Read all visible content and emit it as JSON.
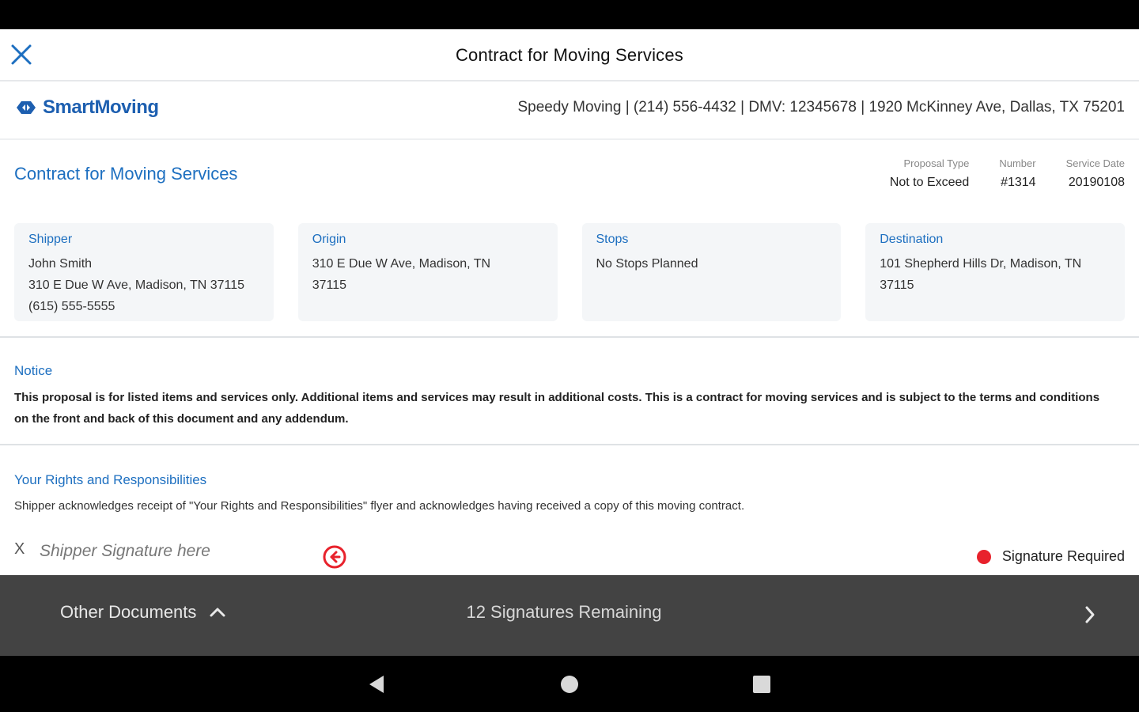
{
  "topbar": {
    "title": "Contract for Moving Services"
  },
  "company": {
    "logo_text": "SmartMoving",
    "info": "Speedy Moving | (214) 556-4432 | DMV: 12345678 | 1920 McKinney Ave, Dallas, TX 75201"
  },
  "document": {
    "title": "Contract for Moving Services",
    "meta": [
      {
        "label": "Proposal Type",
        "value": "Not to Exceed"
      },
      {
        "label": "Number",
        "value": "#1314"
      },
      {
        "label": "Service Date",
        "value": "20190108"
      }
    ]
  },
  "cards": [
    {
      "title": "Shipper",
      "lines": [
        "John Smith",
        "310 E Due W Ave, Madison, TN 37115",
        "(615) 555-5555"
      ]
    },
    {
      "title": "Origin",
      "lines": [
        "310 E Due W Ave, Madison, TN",
        "37115"
      ]
    },
    {
      "title": "Stops",
      "lines": [
        "No Stops Planned"
      ]
    },
    {
      "title": "Destination",
      "lines": [
        "101 Shepherd Hills Dr, Madison, TN",
        "37115"
      ]
    }
  ],
  "notice": {
    "title": "Notice",
    "text": "This proposal is for listed items and services only. Additional items and services may result in additional costs. This is a contract for moving services and is subject to the terms and conditions on the front and back of this document and any addendum."
  },
  "rights": {
    "title": "Your Rights and Responsibilities",
    "text": "Shipper acknowledges receipt of \"Your Rights and Responsibilities\" flyer and acknowledges having received a copy of this moving contract.",
    "sig_x": "X",
    "sig_placeholder": "Shipper Signature here",
    "required_label": "Signature Required"
  },
  "bottom_bar": {
    "other_docs_label": "Other Documents",
    "signatures_remaining": "12 Signatures Remaining"
  },
  "colors": {
    "accent": "#1d6fc0",
    "brand": "#1d5fb0",
    "required": "#e8222c",
    "bottom_bar": "#434343"
  },
  "icons": {
    "close": "close-icon",
    "logo": "smartmoving-logo-icon",
    "sig_arrow": "arrow-left-circle-icon",
    "chevron_up": "chevron-up-icon",
    "chevron_right": "chevron-right-icon",
    "nav_back": "back-triangle-icon",
    "nav_home": "home-circle-icon",
    "nav_recents": "recents-square-icon"
  }
}
